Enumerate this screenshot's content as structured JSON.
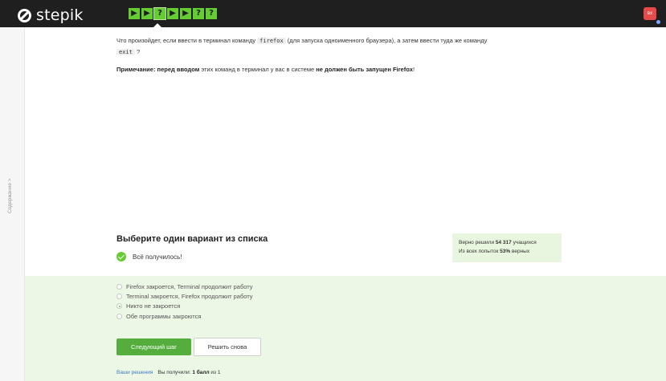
{
  "brand": {
    "name": "stepik"
  },
  "steps": [
    {
      "type": "video",
      "glyph": "▶"
    },
    {
      "type": "video",
      "glyph": "▶"
    },
    {
      "type": "quiz",
      "glyph": "?"
    },
    {
      "type": "video",
      "glyph": "▶"
    },
    {
      "type": "video",
      "glyph": "▶"
    },
    {
      "type": "quiz",
      "glyph": "?"
    },
    {
      "type": "quiz",
      "glyph": "?"
    }
  ],
  "user": {
    "initials": "вх"
  },
  "sidebar": {
    "toggle_label": "Содержание >"
  },
  "question": {
    "text_before": "Что произойдет, если ввести в терминал команду ",
    "code1": "firefox",
    "text_middle": " (для запуска одноименного браузера), а затем ввести туда же команду ",
    "code2": "exit",
    "text_after": " ?"
  },
  "note": {
    "label": "Примечание: ",
    "emph1": "перед вводом",
    "middle": " этих команд в терминал у вас в системе ",
    "emph2": "не должен быть запущен Firefox",
    "end": "!"
  },
  "task": {
    "title": "Выберите один вариант из списка",
    "status": "Всё получилось!"
  },
  "stats": {
    "line1_prefix": "Верно решили ",
    "solved_count": "54 317",
    "line1_suffix": " учащихся",
    "line2_prefix": "Из всех попыток ",
    "percent": "53%",
    "line2_suffix": " верных"
  },
  "options": [
    {
      "label": "Firefox закроется, Terminal продолжит работу",
      "checked": false
    },
    {
      "label": "Terminal закроется, Firefox продолжит работу",
      "checked": false
    },
    {
      "label": "Никто не закроется",
      "checked": true
    },
    {
      "label": "Обе программы закроются",
      "checked": false
    }
  ],
  "buttons": {
    "next": "Следующий шаг",
    "retry": "Решить снова"
  },
  "footer": {
    "solutions_link": "Ваши решения",
    "score_prefix": "Вы получили: ",
    "score_value": "1 балл",
    "score_suffix": " из 1"
  },
  "colors": {
    "accent": "#66cc33",
    "topbar": "#1f1f1f",
    "answer_bg": "#edf7e6",
    "avatar": "#e84a4a"
  }
}
